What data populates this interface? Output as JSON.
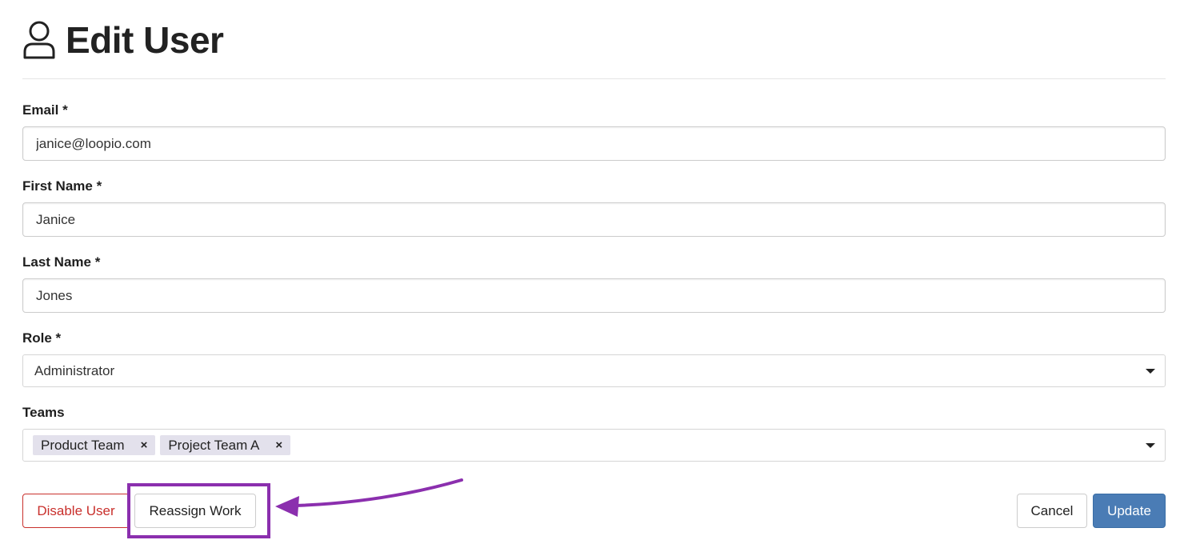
{
  "header": {
    "title": "Edit User",
    "icon": "user-icon"
  },
  "form": {
    "email": {
      "label": "Email *",
      "value": "janice@loopio.com"
    },
    "first_name": {
      "label": "First Name *",
      "value": "Janice"
    },
    "last_name": {
      "label": "Last Name *",
      "value": "Jones"
    },
    "role": {
      "label": "Role *",
      "selected": "Administrator"
    },
    "teams": {
      "label": "Teams",
      "selected": [
        {
          "label": "Product Team",
          "remove": "×"
        },
        {
          "label": "Project Team A",
          "remove": "×"
        }
      ]
    }
  },
  "actions": {
    "disable_label": "Disable User",
    "reassign_label": "Reassign Work",
    "cancel_label": "Cancel",
    "update_label": "Update"
  },
  "annotation": {
    "highlight_color": "#8b2fae"
  },
  "colors": {
    "danger": "#c9302c",
    "primary": "#4a7cb5",
    "tag_bg": "#e3e1ec",
    "text": "#222222"
  }
}
